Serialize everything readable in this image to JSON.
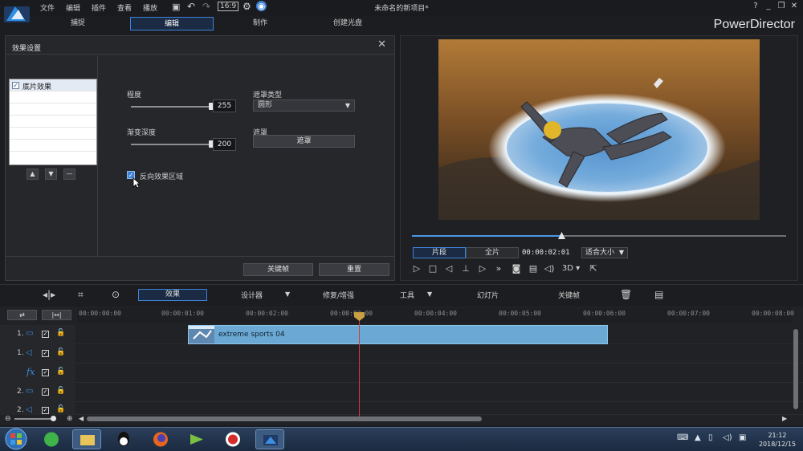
{
  "app": {
    "menu": [
      "文件",
      "编辑",
      "插件",
      "查看",
      "播放"
    ],
    "window_title": "未命名的新项目*",
    "app_name": "PowerDirector",
    "window_buttons": [
      "?",
      "_",
      "❐",
      "✕"
    ]
  },
  "tabs": [
    {
      "label": "捕捉",
      "active": false
    },
    {
      "label": "编辑",
      "active": true
    },
    {
      "label": "制作",
      "active": false
    },
    {
      "label": "创建光盘",
      "active": false
    }
  ],
  "dialog": {
    "title": "效果设置",
    "effects": [
      {
        "label": "底片效果",
        "checked": true
      }
    ],
    "degree_label": "程度",
    "degree_value": "255",
    "degree_level": 1.0,
    "gradient_label": "渐变深度",
    "gradient_value": "200",
    "gradient_level": 1.0,
    "mask_type_label": "遮罩类型",
    "mask_type_value": "圆形",
    "mask_label": "遮罩",
    "mask_button": "遮罩",
    "invert_label": "反向效果区域",
    "invert_checked": true,
    "keyframe_button": "关键帧",
    "reset_button": "重置"
  },
  "preview": {
    "mode_clip": "片段",
    "mode_full": "全片",
    "timecode": "00:00:02:01",
    "fit": "适合大小",
    "stereo": "3D",
    "progress": 0.4
  },
  "toolbar": {
    "effect": "效果",
    "designer": "设计器",
    "repair": "修复/增强",
    "tools": "工具",
    "slideshow": "幻灯片",
    "keyframe": "关键帧"
  },
  "timeline": {
    "ruler": [
      "00:00:00:00",
      "00:00:01:00",
      "00:00:02:00",
      "00:00:03:00",
      "00:00:04:00",
      "00:00:05:00",
      "00:00:06:00",
      "00:00:07:00",
      "00:00:08:00"
    ],
    "tracks": [
      {
        "num": "1.",
        "kind": "video"
      },
      {
        "num": "1.",
        "kind": "audio"
      },
      {
        "num": "",
        "kind": "fx"
      },
      {
        "num": "2.",
        "kind": "video"
      },
      {
        "num": "2.",
        "kind": "audio"
      }
    ],
    "clip_name": "extreme sports 04"
  },
  "taskbar": {
    "time": "21:12",
    "date": "2018/12/15"
  }
}
